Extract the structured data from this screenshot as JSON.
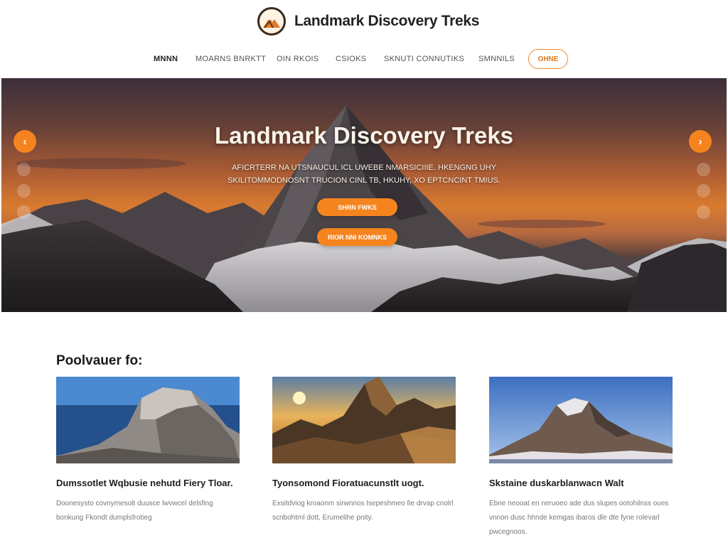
{
  "brand": {
    "name": "Landmark Discovery Treks",
    "logo_icon": "mountain-icon"
  },
  "nav": {
    "items": [
      "MNNN",
      "MOARNS BNRKTT",
      "OIN RKOIS",
      "CSIOKS",
      "SKNUTI CONNUTIKS",
      "SMNNILS"
    ],
    "cta_label": "OHNE"
  },
  "hero": {
    "title": "Landmark Discovery Treks",
    "subtitle_line1": "AFICRTERR NA UTSNAUCUL ICL UWEBE NMARSICIIIE. HKENGNG UHY",
    "subtitle_line2": "SKILITOMMODNOSNT TRUCION CINL TB, HKUHY, XO EPTCNCINT TMIUS.",
    "primary_button": "SHRN FWKS",
    "secondary_button": "RIOR NNI KOMNKS",
    "prev_icon": "chevron-left-icon",
    "next_icon": "chevron-right-icon",
    "accent_color": "#f5841f"
  },
  "featured": {
    "title": "Poolvauer fo:",
    "cards": [
      {
        "title": "Dumssotlet Wqbusie nehutd Fiery Tloar.",
        "text": "Doonesysto covnymesolt duusce lwvwcel delsfing bonkung Fkondt dumplsfrotieg"
      },
      {
        "title": "Tyonsomond Fioratuacunstlt uogt.",
        "text": "Exsitdviog kroaonm sirwnnos Isepeshmeo fie drvap cnolrl scnbohtml dott, Erumelihe pnity."
      },
      {
        "title": "Skstaine duskarblanwacn Walt",
        "text": "Ebne neooat en neruoeo ade dus slupes ootohilnss oues vnnon dusc hhnde kemgas ibaros dle dte fyne rolevarl pwcegnoos."
      }
    ]
  }
}
